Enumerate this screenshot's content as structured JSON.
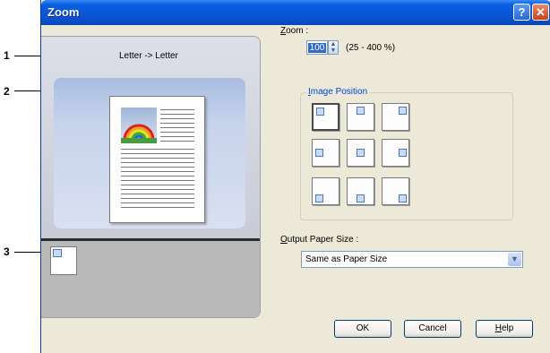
{
  "callouts": [
    "1",
    "2",
    "3"
  ],
  "window": {
    "title": "Zoom",
    "help_glyph": "?",
    "close_glyph": "✕"
  },
  "preview": {
    "size_text": "Letter -> Letter"
  },
  "zoom": {
    "label_prefix": "Z",
    "label_rest": "oom :",
    "value": "100",
    "range_text": "(25 - 400 %)"
  },
  "image_position": {
    "title_prefix": "I",
    "title_rest": "mage Position",
    "options": [
      "top-left",
      "top-center",
      "top-right",
      "middle-left",
      "center",
      "middle-right",
      "bottom-left",
      "bottom-center",
      "bottom-right"
    ],
    "selected": "top-left"
  },
  "output_paper_size": {
    "label_prefix": "O",
    "label_rest": "utput Paper Size :",
    "value": "Same as Paper Size"
  },
  "buttons": {
    "ok": "OK",
    "cancel": "Cancel",
    "help_prefix": "H",
    "help_rest": "elp"
  },
  "colors": {
    "titlebar": "#0a55d8",
    "dialog_bg": "#ece9d8",
    "group_title": "#0046d5"
  }
}
